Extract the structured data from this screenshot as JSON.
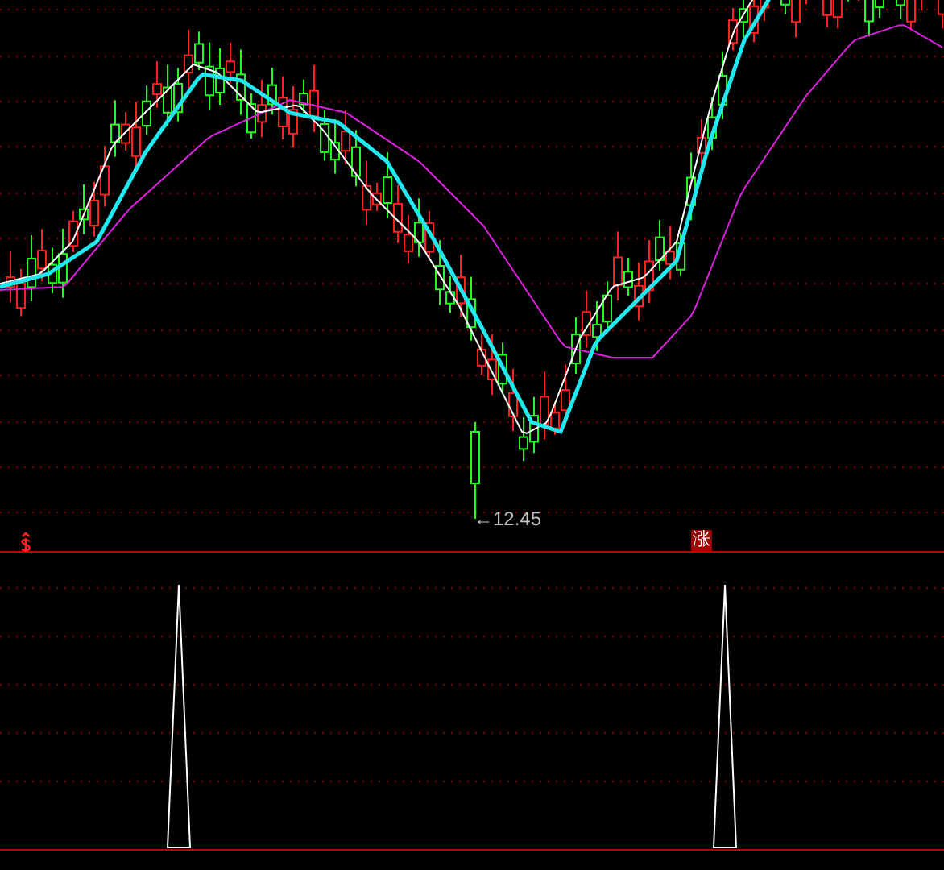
{
  "price_chart": {
    "low_label": "←12.45"
  },
  "signal_bar": {
    "markers": [
      {
        "kind": "sell"
      },
      {
        "kind": "rise",
        "label": "涨"
      }
    ]
  }
}
